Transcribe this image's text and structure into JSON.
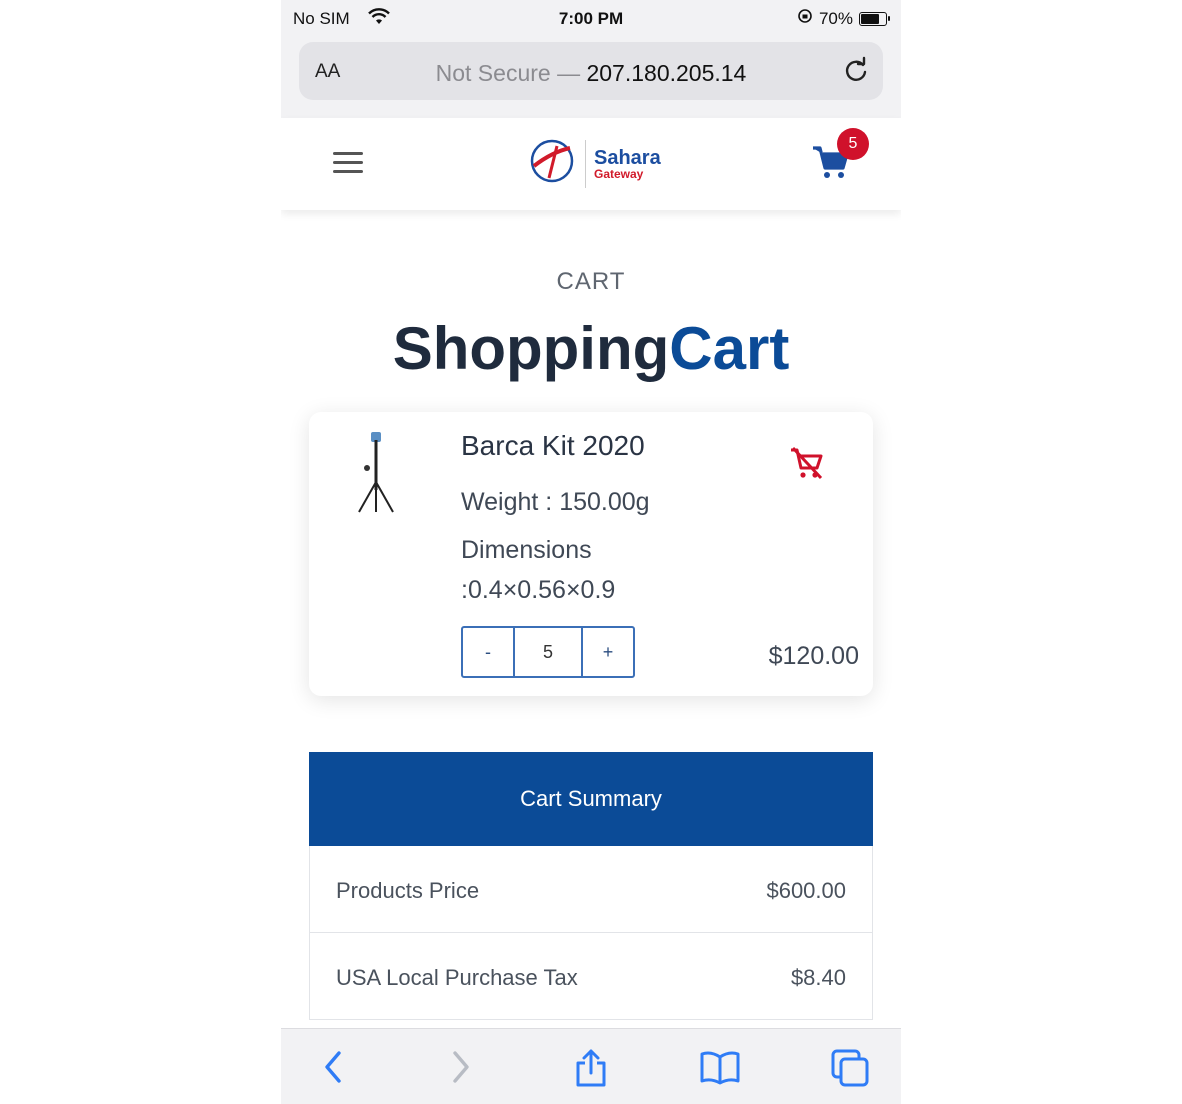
{
  "status_bar": {
    "carrier": "No SIM",
    "time": "7:00 PM",
    "battery": "70%",
    "battery_level": 0.7
  },
  "url_bar": {
    "text_size_label": "AA",
    "not_secure": "Not Secure —",
    "host": "207.180.205.14"
  },
  "header": {
    "logo_line1": "Sahara",
    "logo_line2": "Gateway",
    "cart_count": "5"
  },
  "page": {
    "eyebrow": "CART",
    "title_part1": "Shopping",
    "title_part2": "Cart"
  },
  "cart_item": {
    "name": "Barca Kit 2020",
    "weight": "Weight : 150.00g",
    "dimensions_label": "Dimensions",
    "dimensions_value": ":0.4×0.56×0.9",
    "qty_minus": "-",
    "quantity": "5",
    "qty_plus": "+",
    "price": "$120.00"
  },
  "summary": {
    "header": "Cart Summary",
    "rows": [
      {
        "label": "Products Price",
        "amount": "$600.00"
      },
      {
        "label": "USA Local Purchase Tax",
        "amount": "$8.40"
      }
    ]
  },
  "colors": {
    "brand_blue": "#0b4b97",
    "badge_red": "#d0112b",
    "ios_blue": "#2f7cf6"
  },
  "toolbar_icons": [
    "back-icon",
    "forward-icon",
    "share-icon",
    "bookmarks-icon",
    "tabs-icon"
  ]
}
